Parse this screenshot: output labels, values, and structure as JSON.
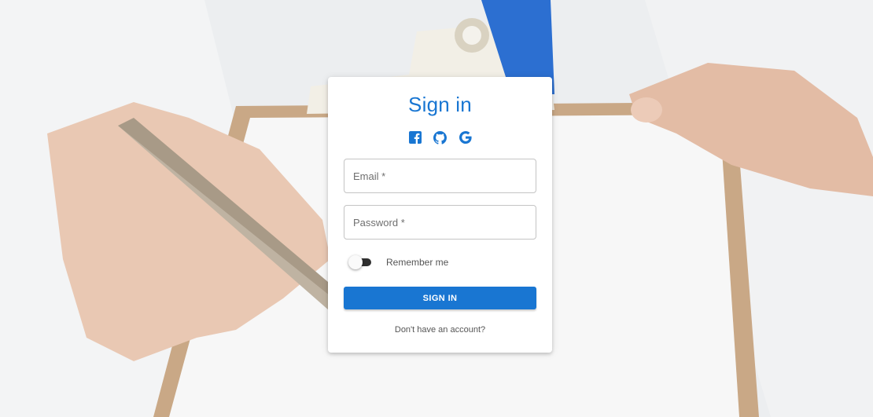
{
  "signin": {
    "title": "Sign in",
    "social": [
      {
        "icon": "facebook-icon"
      },
      {
        "icon": "github-icon"
      },
      {
        "icon": "google-icon"
      }
    ],
    "email_placeholder": "Email *",
    "password_placeholder": "Password *",
    "remember_label": "Remember me",
    "remember_checked": false,
    "submit_label": "SIGN IN",
    "signup_link": "Don't have an account?"
  },
  "colors": {
    "primary": "#1976d2",
    "card": "#ffffff"
  }
}
